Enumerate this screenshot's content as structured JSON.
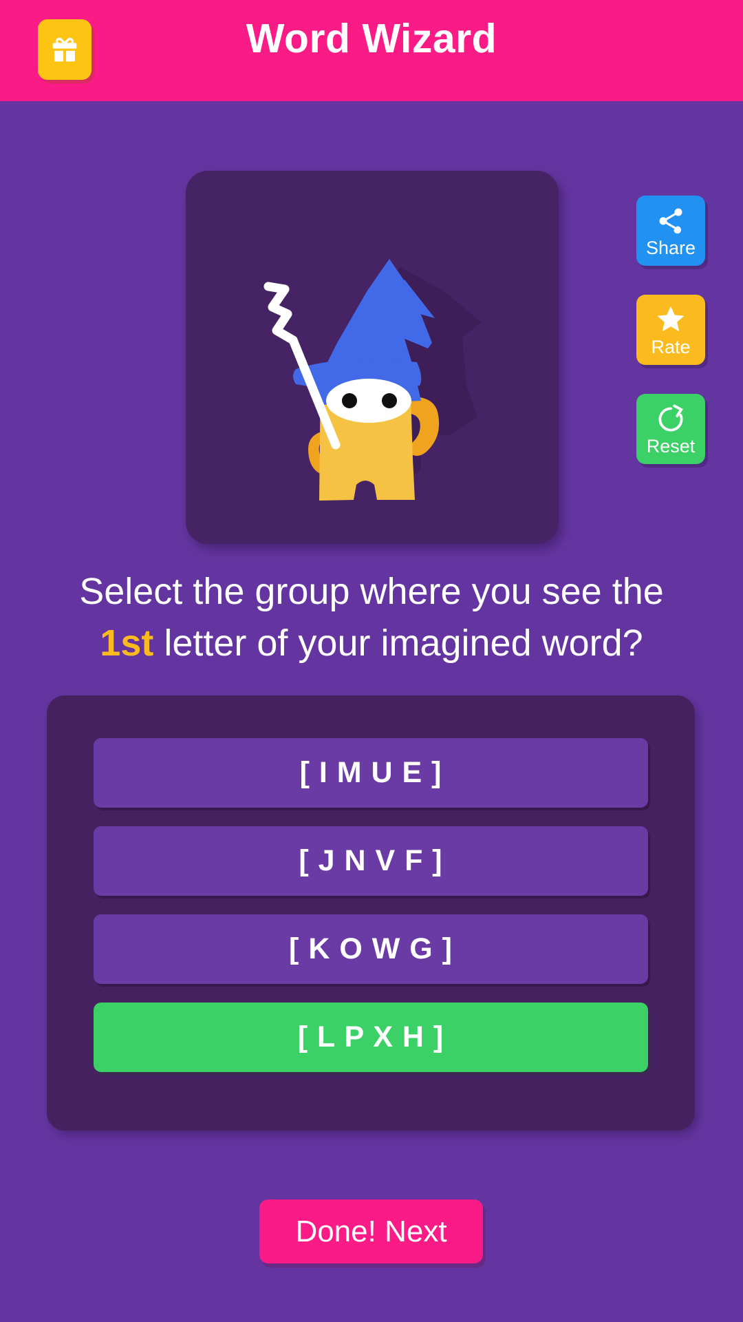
{
  "header": {
    "title": "Word Wizard",
    "gift_icon": "gift-icon",
    "background_color": "#FA1B87"
  },
  "wizard_card": {
    "background_color": "#452364",
    "illustration": "wizard-mascot",
    "hat_color": "#4169E8",
    "body_color": "#F5C243",
    "wand_color": "#FFFFFF"
  },
  "side_buttons": [
    {
      "label": "Share",
      "icon": "share-icon",
      "color": "#2191F2"
    },
    {
      "label": "Rate",
      "icon": "star-icon",
      "color": "#FBBB1E"
    },
    {
      "label": "Reset",
      "icon": "refresh-icon",
      "color": "#3BD167"
    }
  ],
  "question": {
    "line1": "Select the group where you see the",
    "highlight": "1st",
    "line2_rest": " letter of your imagined word?",
    "highlight_color": "#FBBB1E"
  },
  "options": [
    {
      "label": "[ I M U E ]",
      "selected": false
    },
    {
      "label": "[ J N V F ]",
      "selected": false
    },
    {
      "label": "[ K O W G ]",
      "selected": false
    },
    {
      "label": "[ L P X H ]",
      "selected": true
    }
  ],
  "next_button": {
    "label": "Done! Next",
    "color": "#FA1B87"
  },
  "theme": {
    "background_color": "#6435A0",
    "card_color": "#46215F",
    "option_color": "#6A3BA4",
    "selected_color": "#3BD167"
  }
}
